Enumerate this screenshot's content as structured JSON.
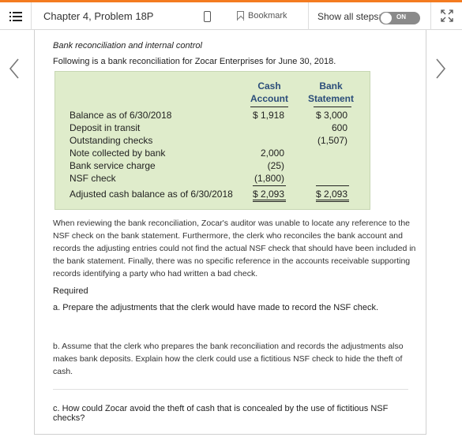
{
  "header": {
    "chapter_title": "Chapter 4, Problem 18P",
    "bookmark_label": "Bookmark",
    "show_steps_label": "Show all steps:",
    "toggle_label": "ON",
    "accent_color": "#f47b20"
  },
  "problem": {
    "title": "Bank reconciliation and internal control",
    "intro": "Following is a bank reconciliation for Zocar Enterprises for June 30, 2018.",
    "table": {
      "cash_header_1": "Cash",
      "cash_header_2": "Account",
      "bank_header_1": "Bank",
      "bank_header_2": "Statement",
      "rows": [
        {
          "label": "Balance as of 6/30/2018",
          "cash": "$ 1,918",
          "bank": "$ 3,000"
        },
        {
          "label": "Deposit in transit",
          "cash": "",
          "bank": "600"
        },
        {
          "label": "Outstanding checks",
          "cash": "",
          "bank": "(1,507)"
        },
        {
          "label": "Note collected by bank",
          "cash": "2,000",
          "bank": ""
        },
        {
          "label": "Bank service charge",
          "cash": "(25)",
          "bank": ""
        },
        {
          "label": "NSF check",
          "cash": "(1,800)",
          "bank": ""
        },
        {
          "label": "Adjusted cash balance as of 6/30/2018",
          "cash": "$ 2,093",
          "bank": "$ 2,093"
        }
      ]
    },
    "paragraph": "When reviewing the bank reconciliation, Zocar's auditor was unable to locate any reference to the NSF check on the bank statement. Furthermore, the clerk who reconciles the bank account and records the adjusting entries could not find the actual NSF check that should have been included in the bank statement. Finally, there was no specific reference in the accounts receivable supporting records identifying a party who had written a bad check.",
    "required_label": "Required",
    "question_a": "a. Prepare the adjustments that the clerk would have made to record the NSF check.",
    "question_b": "b. Assume that the clerk who prepares the bank reconciliation and records the adjustments also makes bank deposits. Explain how the clerk could use a fictitious NSF check to hide the theft of cash.",
    "question_c": "c. How could Zocar avoid the theft of cash that is concealed by the use of fictitious NSF checks?"
  },
  "icons": {
    "menu": "menu-icon",
    "device": "device-icon",
    "bookmark": "bookmark-icon",
    "expand": "expand-icon",
    "prev": "chevron-left-icon",
    "next": "chevron-right-icon"
  }
}
